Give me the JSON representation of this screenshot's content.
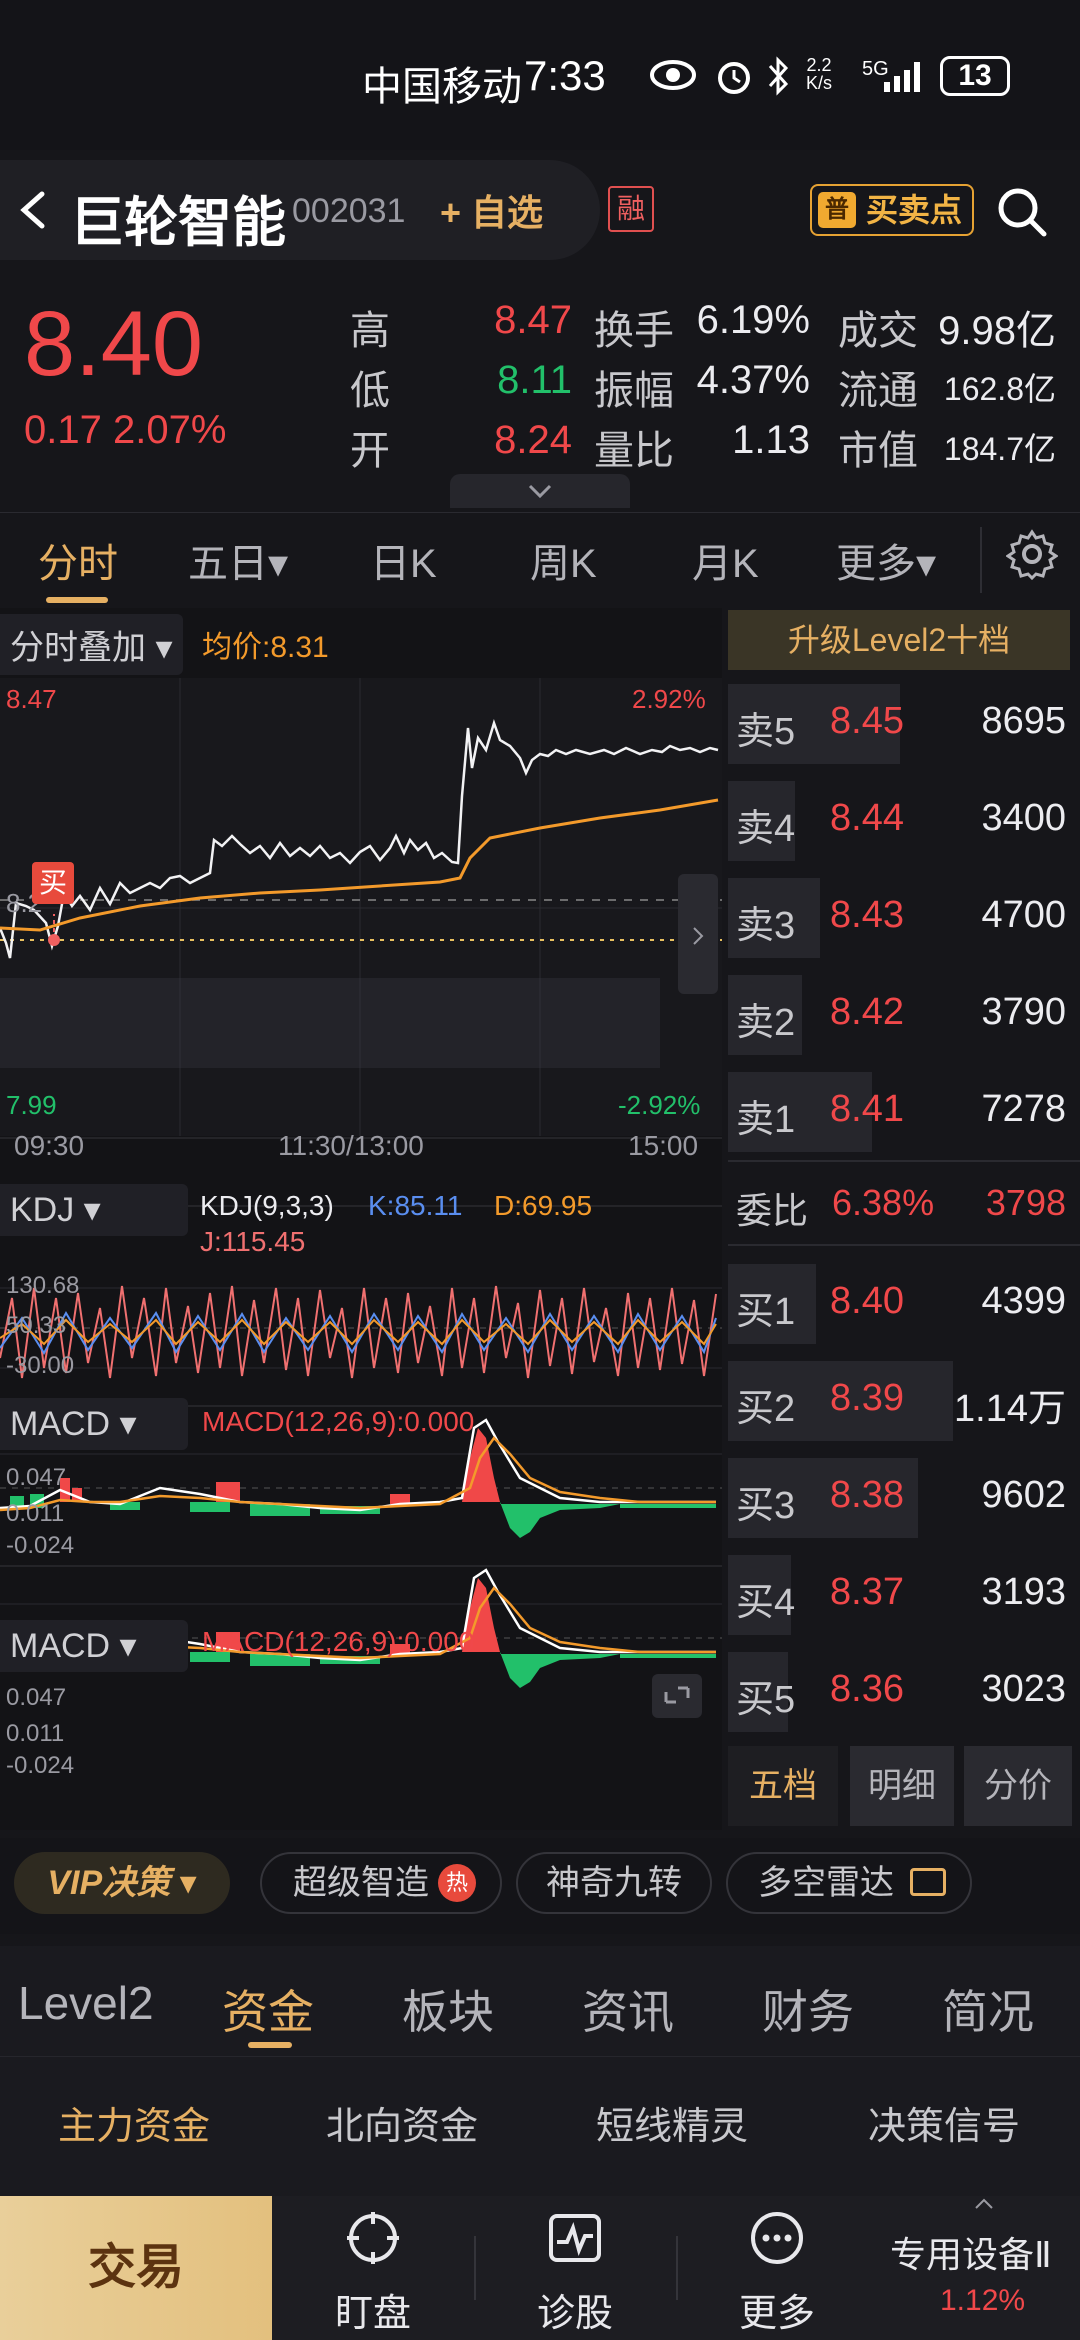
{
  "status_bar": {
    "carrier": "中国移动",
    "time": "7:33",
    "net_speed_top": "2.2",
    "net_speed_bottom": "K/s",
    "network": "5G",
    "battery": "13"
  },
  "header": {
    "stock_name": "巨轮智能",
    "stock_code": "002031",
    "add_watchlist": "+ 自选",
    "margin_badge": "融",
    "buy_sell_label": "买卖点",
    "buy_sell_icon_text": "普"
  },
  "quote": {
    "price": "8.40",
    "change": "0.17",
    "change_pct": "2.07%",
    "rows": [
      {
        "l1": "高",
        "v1": "8.47",
        "c1": "red",
        "l2": "换手",
        "v2": "6.19%",
        "l3": "成交",
        "v3": "9.98亿"
      },
      {
        "l1": "低",
        "v1": "8.11",
        "c1": "green",
        "l2": "振幅",
        "v2": "4.37%",
        "l3": "流通",
        "v3": "162.8亿"
      },
      {
        "l1": "开",
        "v1": "8.24",
        "c1": "red",
        "l2": "量比",
        "v2": "1.13",
        "l3": "市值",
        "v3": "184.7亿"
      }
    ]
  },
  "chart_tabs": [
    "分时",
    "五日▾",
    "日K",
    "周K",
    "月K",
    "更多▾"
  ],
  "intraday": {
    "overlay_label": "分时叠加 ▾",
    "avg_price_label": "均价:8.31",
    "high_label": "8.47",
    "low_label": "7.99",
    "high_pct": "2.92%",
    "low_pct": "-2.92%",
    "mid_label": "8.2",
    "time_labels": [
      "09:30",
      "11:30/13:00",
      "15:00"
    ],
    "buy_marker": "买"
  },
  "kdj": {
    "selector": "KDJ ▾",
    "params": "KDJ(9,3,3)",
    "k": "K:85.11",
    "d": "D:69.95",
    "j": "J:115.45",
    "y_top": "130.68",
    "y_mid": "50.33",
    "y_bottom": "-30.00"
  },
  "macd1": {
    "selector": "MACD ▾",
    "params": "MACD(12,26,9):0.000",
    "y_top": "0.047",
    "y_mid": "0.011",
    "y_bottom": "-0.024"
  },
  "macd2": {
    "selector": "MACD ▾",
    "params": "MACD(12,26,9):0.000",
    "y_top": "0.047",
    "y_mid": "0.011",
    "y_bottom": "-0.024"
  },
  "orderbook": {
    "upgrade_label": "升级Level2十档",
    "sell": [
      {
        "label": "卖5",
        "price": "8.45",
        "vol": "8695",
        "bar": 0.49
      },
      {
        "label": "卖4",
        "price": "8.44",
        "vol": "3400",
        "bar": 0.19
      },
      {
        "label": "卖3",
        "price": "8.43",
        "vol": "4700",
        "bar": 0.26
      },
      {
        "label": "卖2",
        "price": "8.42",
        "vol": "3790",
        "bar": 0.21
      },
      {
        "label": "卖1",
        "price": "8.41",
        "vol": "7278",
        "bar": 0.41
      }
    ],
    "ratio_label": "委比",
    "ratio_pct": "6.38%",
    "ratio_vol": "3798",
    "buy": [
      {
        "label": "买1",
        "price": "8.40",
        "vol": "4399",
        "bar": 0.25
      },
      {
        "label": "买2",
        "price": "8.39",
        "vol": "1.14万",
        "bar": 0.64
      },
      {
        "label": "买3",
        "price": "8.38",
        "vol": "9602",
        "bar": 0.54
      },
      {
        "label": "买4",
        "price": "8.37",
        "vol": "3193",
        "bar": 0.18
      },
      {
        "label": "买5",
        "price": "8.36",
        "vol": "3023",
        "bar": 0.17
      }
    ],
    "tabs": [
      "五档",
      "明细",
      "分价"
    ]
  },
  "feature_bar": {
    "vip": "VIP决策 ▾",
    "pills": [
      "超级智造",
      "神奇九转",
      "多空雷达"
    ],
    "hot_badge": "热"
  },
  "info_tabs": [
    "Level2",
    "资金",
    "板块",
    "资讯",
    "财务",
    "简况"
  ],
  "sub_tabs": [
    "主力资金",
    "北向资金",
    "短线精灵",
    "决策信号"
  ],
  "bottom_nav": {
    "trade": "交易",
    "items": [
      "盯盘",
      "诊股",
      "更多"
    ],
    "special_label": "专用设备Ⅱ",
    "special_pct": "1.12%"
  },
  "colors": {
    "up": "#f0484a",
    "down": "#22c06a",
    "accent": "#e6b063",
    "avg_line": "#f39a2b"
  }
}
